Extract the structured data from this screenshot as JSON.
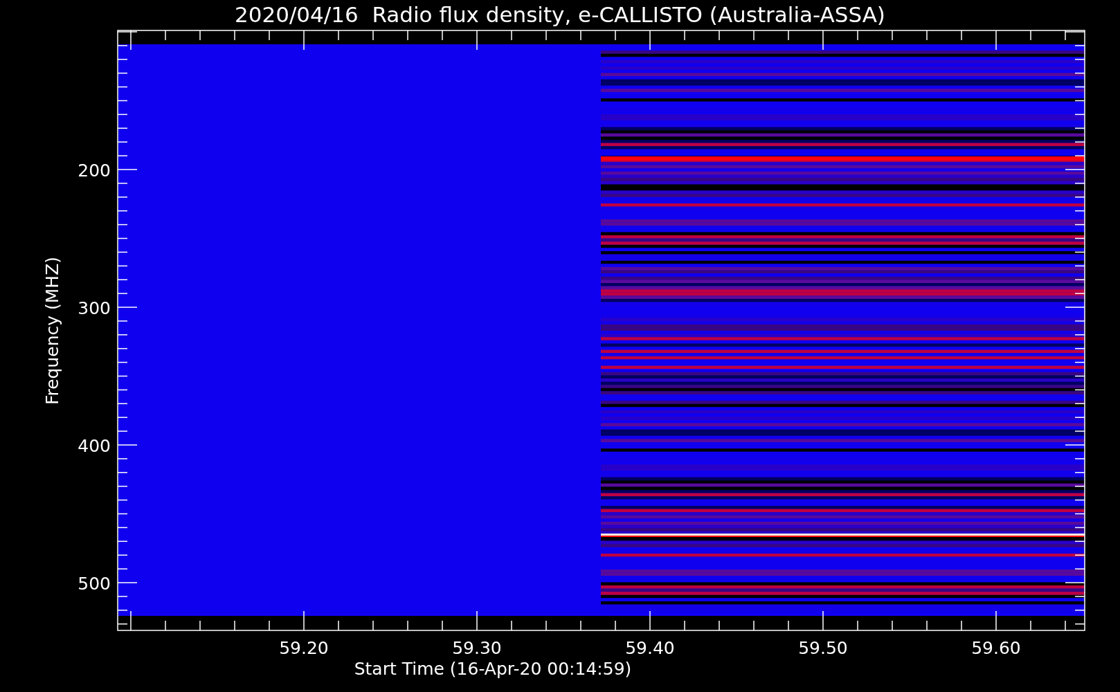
{
  "title": "2020/04/16  Radio flux density, e-CALLISTO (Australia-ASSA)",
  "y_axis": {
    "label": "Frequency (MHZ)",
    "ticks": [
      "200",
      "300",
      "400",
      "500"
    ]
  },
  "x_axis": {
    "label": "Start Time (16-Apr-20 00:14:59)",
    "ticks": [
      "59.20",
      "59.30",
      "59.40",
      "59.50",
      "59.60"
    ]
  }
}
